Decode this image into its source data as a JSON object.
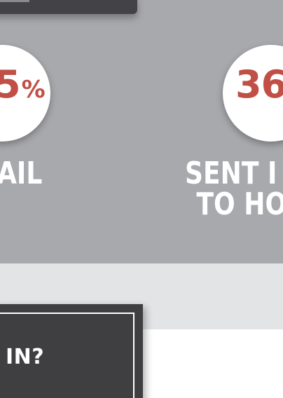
{
  "stats": [
    {
      "number": "5",
      "unit": "%",
      "label_lines": [
        "AIL"
      ]
    },
    {
      "number": "36",
      "unit": "",
      "label_lines": [
        "SENT I",
        "TO HO"
      ]
    }
  ],
  "callout": {
    "text": "IN?"
  },
  "colors": {
    "band": "#a8a9ad",
    "accent": "#c14f46",
    "dark_box": "#3f3f41",
    "light_band": "#e3e4e6"
  }
}
